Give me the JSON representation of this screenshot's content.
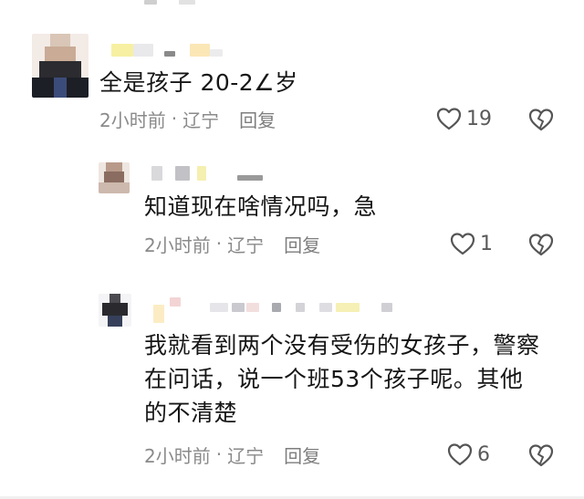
{
  "comments": [
    {
      "text": "全是孩子 20-2∠岁",
      "time": "2小时前",
      "separator": "·",
      "location": "辽宁",
      "reply_label": "回复",
      "likes": "19",
      "icons": [
        "heart-outline-icon",
        "broken-heart-icon"
      ]
    },
    {
      "text": "知道现在啥情况吗，急",
      "time": "2小时前",
      "separator": "·",
      "location": "辽宁",
      "reply_label": "回复",
      "likes": "1",
      "icons": [
        "heart-outline-icon",
        "broken-heart-icon"
      ]
    },
    {
      "text_lines": [
        "我就看到两个没有受伤的女孩子，警察",
        "在问话，说一个班53个孩子呢。其他",
        "的不清楚"
      ],
      "time": "2小时前",
      "separator": "·",
      "location": "辽宁",
      "reply_label": "回复",
      "likes": "6",
      "icons": [
        "heart-outline-icon",
        "broken-heart-icon"
      ]
    }
  ],
  "colors": {
    "text": "#161616",
    "meta": "#8a8a8a",
    "icon": "#555555"
  }
}
